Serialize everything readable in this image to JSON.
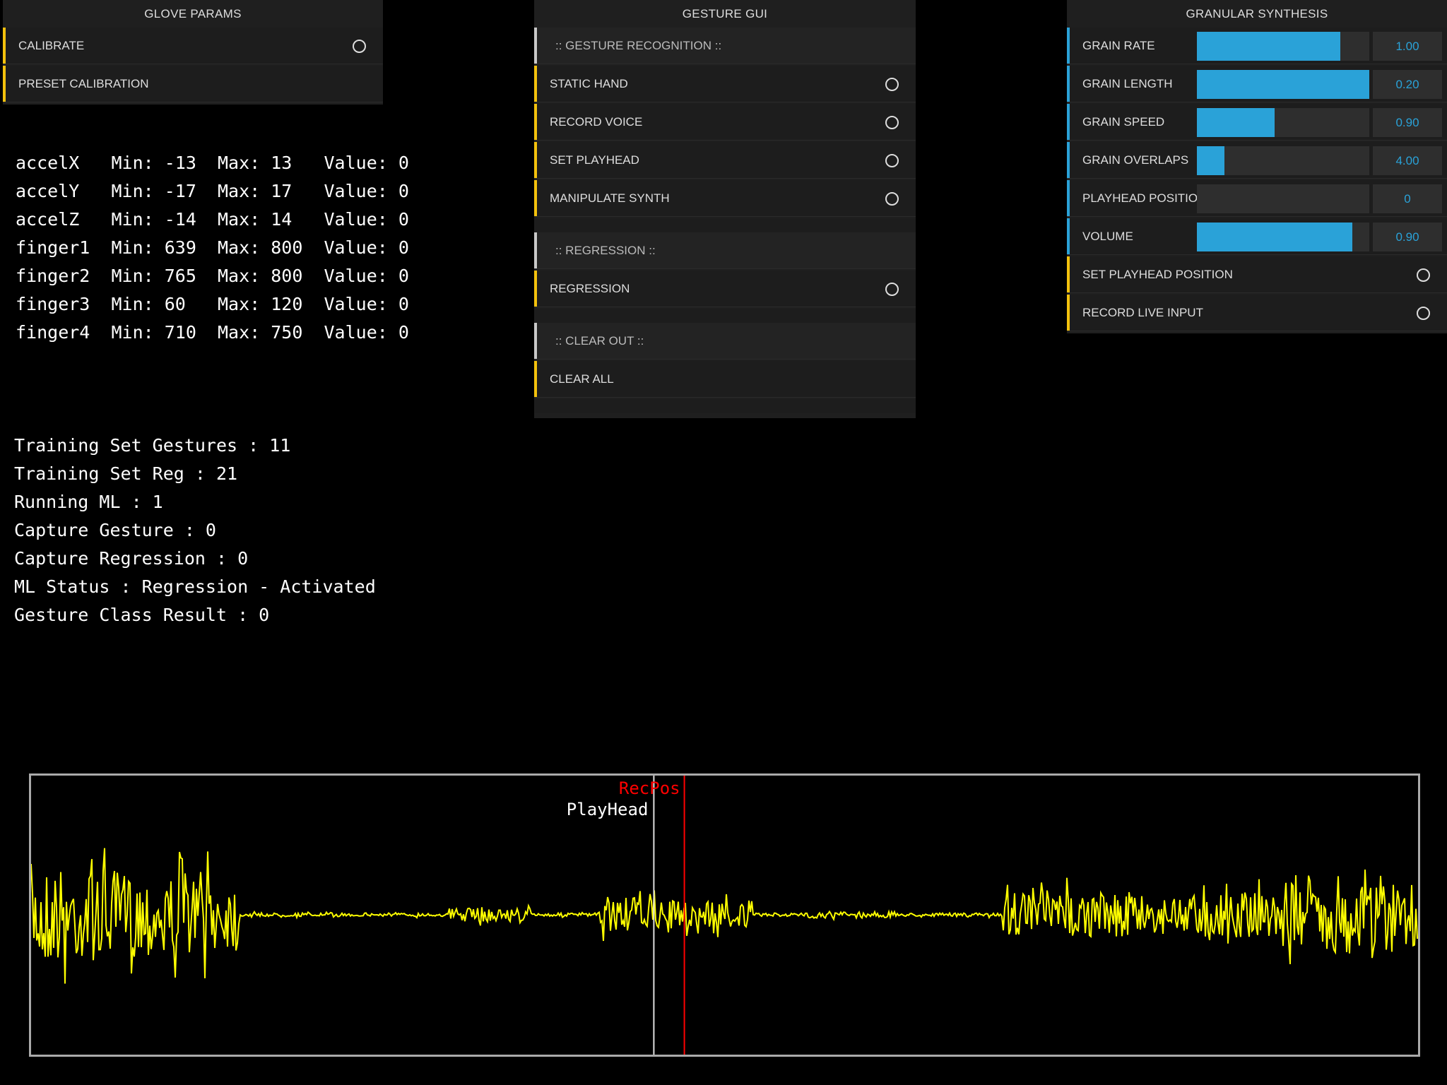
{
  "glove_params": {
    "title": "GLOVE PARAMS",
    "items": [
      {
        "label": "CALIBRATE",
        "toggle": true
      },
      {
        "label": "PRESET CALIBRATION",
        "toggle": false
      }
    ]
  },
  "gesture_gui": {
    "title": "GESTURE GUI",
    "rows": [
      {
        "type": "section",
        "label": ":: GESTURE RECOGNITION ::"
      },
      {
        "type": "toggle",
        "label": "STATIC HAND"
      },
      {
        "type": "toggle",
        "label": "RECORD VOICE"
      },
      {
        "type": "toggle",
        "label": "SET PLAYHEAD"
      },
      {
        "type": "toggle",
        "label": "MANIPULATE SYNTH"
      },
      {
        "type": "spacer"
      },
      {
        "type": "section",
        "label": ":: REGRESSION ::"
      },
      {
        "type": "toggle",
        "label": "REGRESSION"
      },
      {
        "type": "spacer"
      },
      {
        "type": "section",
        "label": ":: CLEAR OUT ::"
      },
      {
        "type": "button",
        "label": "CLEAR ALL"
      },
      {
        "type": "spacer"
      }
    ]
  },
  "granular_synthesis": {
    "title": "GRANULAR SYNTHESIS",
    "sliders": [
      {
        "label": "GRAIN RATE",
        "value": "1.00",
        "fill": 0.83
      },
      {
        "label": "GRAIN LENGTH",
        "value": "0.20",
        "fill": 1.0
      },
      {
        "label": "GRAIN SPEED",
        "value": "0.90",
        "fill": 0.45
      },
      {
        "label": "GRAIN OVERLAPS",
        "value": "4.00",
        "fill": 0.16
      },
      {
        "label": "PLAYHEAD POSITION",
        "value": "0",
        "fill": 0.0
      },
      {
        "label": "VOLUME",
        "value": "0.90",
        "fill": 0.9
      }
    ],
    "toggles": [
      {
        "label": "SET PLAYHEAD POSITION"
      },
      {
        "label": "RECORD LIVE INPUT"
      }
    ]
  },
  "sensors": [
    {
      "name": "accelX",
      "min": "-13",
      "max": "13",
      "value": "0"
    },
    {
      "name": "accelY",
      "min": "-17",
      "max": "17",
      "value": "0"
    },
    {
      "name": "accelZ",
      "min": "-14",
      "max": "14",
      "value": "0"
    },
    {
      "name": "finger1",
      "min": "639",
      "max": "800",
      "value": "0"
    },
    {
      "name": "finger2",
      "min": "765",
      "max": "800",
      "value": "0"
    },
    {
      "name": "finger3",
      "min": "60",
      "max": "120",
      "value": "0"
    },
    {
      "name": "finger4",
      "min": "710",
      "max": "750",
      "value": "0"
    }
  ],
  "status_lines": [
    "Training Set Gestures : 11",
    "Training Set Reg : 21",
    "Running ML : 1",
    "Capture Gesture : 0",
    "Capture Regression : 0",
    "ML Status : Regression - Activated",
    "Gesture Class Result : 0"
  ],
  "waveform": {
    "recpos_label": "RecPos",
    "playhead_label": "PlayHead",
    "playhead_fraction": 0.449,
    "recpos_fraction": 0.471,
    "wave_color": "#ffff00",
    "recpos_color": "#ff0000",
    "playhead_color": "#dddddd"
  }
}
